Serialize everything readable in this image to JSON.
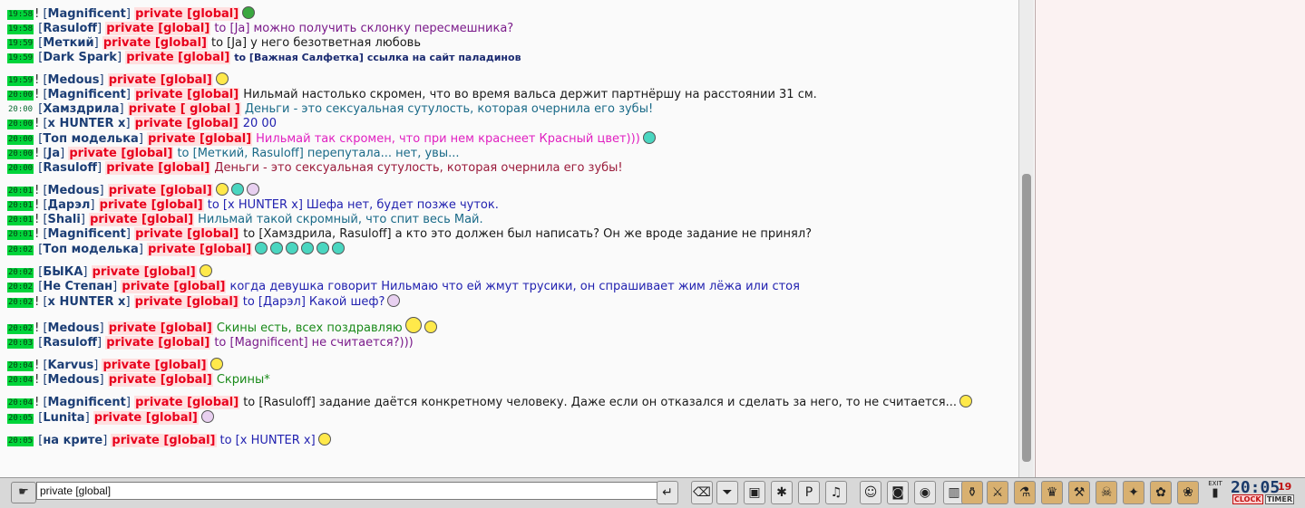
{
  "chat": {
    "lines": [
      {
        "time": "19:58",
        "bang": "!",
        "nick": "Magnificent",
        "priv": "private [global]",
        "to": "",
        "msg": "",
        "msg_color": "",
        "emote": "hat"
      },
      {
        "time": "19:58",
        "bang": "",
        "nick": "Rasuloff",
        "priv": "private [global]",
        "to": "to [Ja]",
        "msg": "можно получить склонку пересмешника?",
        "msg_color": "c-purple",
        "emote": ""
      },
      {
        "time": "19:59",
        "bang": "",
        "nick": "Меткий",
        "priv": "private [global]",
        "to": "to [Ja]",
        "msg": "у него безответная любовь",
        "msg_color": "c-black",
        "emote": ""
      },
      {
        "time": "19:59",
        "bang": "",
        "nick": "Dark Spark",
        "priv": "private [global]",
        "to": "to [Важная Салфетка]",
        "msg": "ссылка на сайт паладинов",
        "msg_color": "c-navy",
        "emote": ""
      },
      {
        "time": "19:59",
        "bang": "!",
        "nick": "Medous",
        "priv": "private [global]",
        "to": "",
        "msg": "",
        "msg_color": "",
        "emote": "yellow",
        "gap": true
      },
      {
        "time": "20:00",
        "bang": "!",
        "nick": "Magnificent",
        "priv": "private [global]",
        "to": "",
        "msg": "Нильмай настолько скромен, что во время вальса держит партнёршу на расстоянии 31 см.",
        "msg_color": "c-black",
        "emote": ""
      },
      {
        "time": "20:00",
        "bang": "",
        "nick": "Хамздрила",
        "priv": "private [ global ]",
        "to": "",
        "msg": "Деньги - это сексуальная сутулость, которая очернила его зубы!",
        "msg_color": "c-teal",
        "emote": "",
        "plain": true
      },
      {
        "time": "20:00",
        "bang": "!",
        "nick": "x HUNTER x",
        "priv": "private [global]",
        "to": "",
        "msg": "20 00",
        "msg_color": "c-blue",
        "emote": ""
      },
      {
        "time": "20:00",
        "bang": "",
        "nick": "Топ моделька",
        "priv": "private [global]",
        "to": "",
        "msg": "Нильмай так скромен, что при нем краснеет Красный цвет)))",
        "msg_color": "c-magenta",
        "emote": "cyan"
      },
      {
        "time": "20:00",
        "bang": "!",
        "nick": "Ja",
        "priv": "private [global]",
        "to": "to [Меткий, Rasuloff]",
        "msg": "перепутала... нет, увы...",
        "msg_color": "c-teal",
        "emote": ""
      },
      {
        "time": "20:00",
        "bang": "",
        "nick": "Rasuloff",
        "priv": "private [global]",
        "to": "",
        "msg": "Деньги - это сексуальная сутулость, которая очернила его зубы!",
        "msg_color": "c-darkred",
        "emote": ""
      },
      {
        "time": "20:01",
        "bang": "!",
        "nick": "Medous",
        "priv": "private [global]",
        "to": "",
        "msg": "",
        "msg_color": "",
        "emote": "multi",
        "gap": true
      },
      {
        "time": "20:01",
        "bang": "!",
        "nick": "Дарэл",
        "priv": "private [global]",
        "to": "to [x HUNTER x]",
        "msg": "Шефа нет, будет позже чуток.",
        "msg_color": "c-blue",
        "emote": ""
      },
      {
        "time": "20:01",
        "bang": "!",
        "nick": "Shali",
        "priv": "private [global]",
        "to": "",
        "msg": "Нильмай такой скромный, что спит весь Май.",
        "msg_color": "c-teal",
        "emote": ""
      },
      {
        "time": "20:01",
        "bang": "!",
        "nick": "Magnificent",
        "priv": "private [global]",
        "to": "to [Хамздрила, Rasuloff]",
        "msg": "а кто это должен был написать? Он же вроде задание не принял?",
        "msg_color": "c-black",
        "emote": ""
      },
      {
        "time": "20:02",
        "bang": "",
        "nick": "Топ моделька",
        "priv": "private [global]",
        "to": "",
        "msg": "",
        "msg_color": "",
        "emote": "cyan6"
      },
      {
        "time": "20:02",
        "bang": "",
        "nick": "БЫКА",
        "priv": "private [global]",
        "to": "",
        "msg": "",
        "msg_color": "",
        "emote": "yellow",
        "gap": true
      },
      {
        "time": "20:02",
        "bang": "",
        "nick": "Не Степан",
        "priv": "private [global]",
        "to": "",
        "msg": "когда девушка говорит Нильмаю что ей жмут трусики, он спрашивает жим лёжа или стоя",
        "msg_color": "c-blue",
        "emote": ""
      },
      {
        "time": "20:02",
        "bang": "!",
        "nick": "x HUNTER x",
        "priv": "private [global]",
        "to": "to [Дарэл]",
        "msg": "Какой шеф?",
        "msg_color": "c-blue",
        "emote": "lilac"
      },
      {
        "time": "20:02",
        "bang": "!",
        "nick": "Medous",
        "priv": "private [global]",
        "to": "",
        "msg": "Скины есть, всех поздравляю",
        "msg_color": "c-green",
        "emote": "party",
        "gap": true
      },
      {
        "time": "20:03",
        "bang": "",
        "nick": "Rasuloff",
        "priv": "private [global]",
        "to": "to [Magnificent]",
        "msg": "не считается?)))",
        "msg_color": "c-purple",
        "emote": ""
      },
      {
        "time": "20:04",
        "bang": "!",
        "nick": "Karvus",
        "priv": "private [global]",
        "to": "",
        "msg": "",
        "msg_color": "",
        "emote": "yellow",
        "gap": true
      },
      {
        "time": "20:04",
        "bang": "!",
        "nick": "Medous",
        "priv": "private [global]",
        "to": "",
        "msg": "Скрины*",
        "msg_color": "c-green",
        "emote": ""
      },
      {
        "time": "20:04",
        "bang": "!",
        "nick": "Magnificent",
        "priv": "private [global]",
        "to": "to [Rasuloff]",
        "msg": "задание даётся конкретному человеку. Даже если он отказался и сделать за него, то не считается...",
        "msg_color": "c-black",
        "emote": "yellow",
        "gap": true
      },
      {
        "time": "20:05",
        "bang": "",
        "nick": "Lunita",
        "priv": "private [global]",
        "to": "",
        "msg": "",
        "msg_color": "",
        "emote": "lilac"
      },
      {
        "time": "20:05",
        "bang": "",
        "nick": "на крите",
        "priv": "private [global]",
        "to": "to [x HUNTER x]",
        "msg": "",
        "msg_color": "",
        "emote": "yellow",
        "gap": true
      }
    ]
  },
  "input": {
    "value": "private [global]"
  },
  "clock": {
    "time": "20:05",
    "seconds": "19",
    "clock_label": "CLOCK",
    "timer_label": "TIMER"
  },
  "exit_label": "EXIT",
  "colors": {
    "timestamp": "#00d43a",
    "private": "#e8001c",
    "nick": "#1c3e75"
  }
}
